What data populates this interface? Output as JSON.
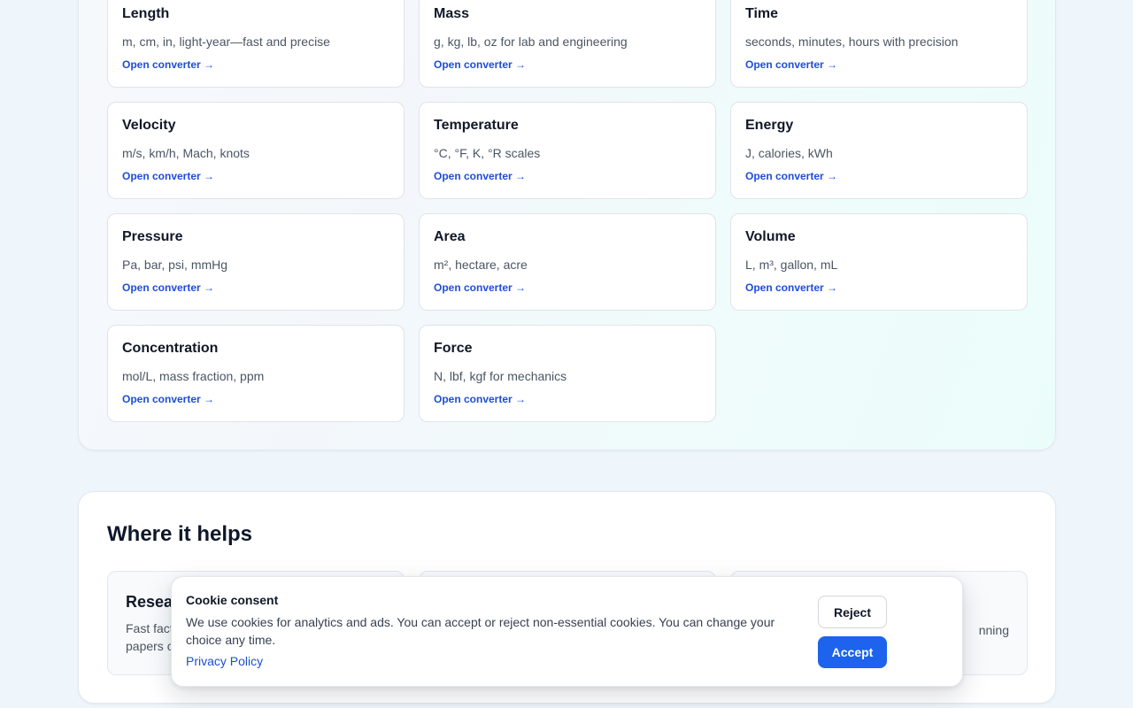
{
  "converters": [
    {
      "title": "Length",
      "desc": "m, cm, in, light-year—fast and precise",
      "link": "Open converter →"
    },
    {
      "title": "Mass",
      "desc": "g, kg, lb, oz for lab and engineering",
      "link": "Open converter →"
    },
    {
      "title": "Time",
      "desc": "seconds, minutes, hours with precision",
      "link": "Open converter →"
    },
    {
      "title": "Velocity",
      "desc": "m/s, km/h, Mach, knots",
      "link": "Open converter →"
    },
    {
      "title": "Temperature",
      "desc": "°C, °F, K, °R scales",
      "link": "Open converter →"
    },
    {
      "title": "Energy",
      "desc": "J, calories, kWh",
      "link": "Open converter →"
    },
    {
      "title": "Pressure",
      "desc": "Pa, bar, psi, mmHg",
      "link": "Open converter →"
    },
    {
      "title": "Area",
      "desc": "m², hectare, acre",
      "link": "Open converter →"
    },
    {
      "title": "Volume",
      "desc": "L, m³, gallon, mL",
      "link": "Open converter →"
    },
    {
      "title": "Concentration",
      "desc": "mol/L, mass fraction, ppm",
      "link": "Open converter →"
    },
    {
      "title": "Force",
      "desc": "N, lbf, kgf for mechanics",
      "link": "Open converter →"
    }
  ],
  "helps": {
    "title": "Where it helps",
    "cards": [
      {
        "title": "Resea",
        "desc": "Fast fact papers c"
      },
      {
        "title": "",
        "desc": ""
      },
      {
        "title": "",
        "desc": "nning"
      }
    ]
  },
  "cookie": {
    "title": "Cookie consent",
    "text": "We use cookies for analytics and ads. You can accept or reject non-essential cookies. You can change your choice any time.",
    "link": "Privacy Policy",
    "reject": "Reject",
    "accept": "Accept"
  },
  "colors": {
    "accent": "#1d63ed",
    "link": "#1d4ed8",
    "background": "#eff6fb"
  }
}
